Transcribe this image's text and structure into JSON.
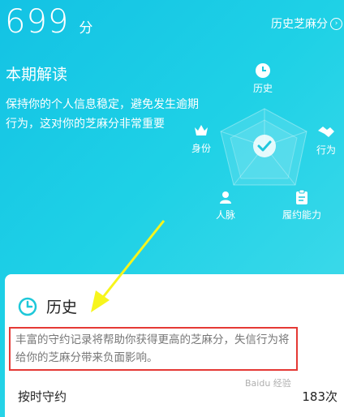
{
  "header": {
    "score": "699",
    "score_unit": "分",
    "history_link": "历史芝麻分"
  },
  "interpretation": {
    "title": "本期解读",
    "text": "保持你的个人信息稳定，避免发生逾期行为，这对你的芝麻分非常重要"
  },
  "radar": {
    "labels": {
      "history": "历史",
      "identity": "身份",
      "behavior": "行为",
      "connections": "人脉",
      "capacity": "履约能力"
    }
  },
  "card": {
    "title": "历史",
    "note": "丰富的守约记录将帮助你获得更高的芝麻分，失信行为将给你的芝麻分带来负面影响。",
    "row": {
      "label": "按时守约",
      "value": "183次"
    }
  },
  "watermark": "Baidu 经验",
  "colors": {
    "accent": "#1ec8d9",
    "highlight_border": "#e53935",
    "pointer_arrow": "#f7f51c"
  }
}
